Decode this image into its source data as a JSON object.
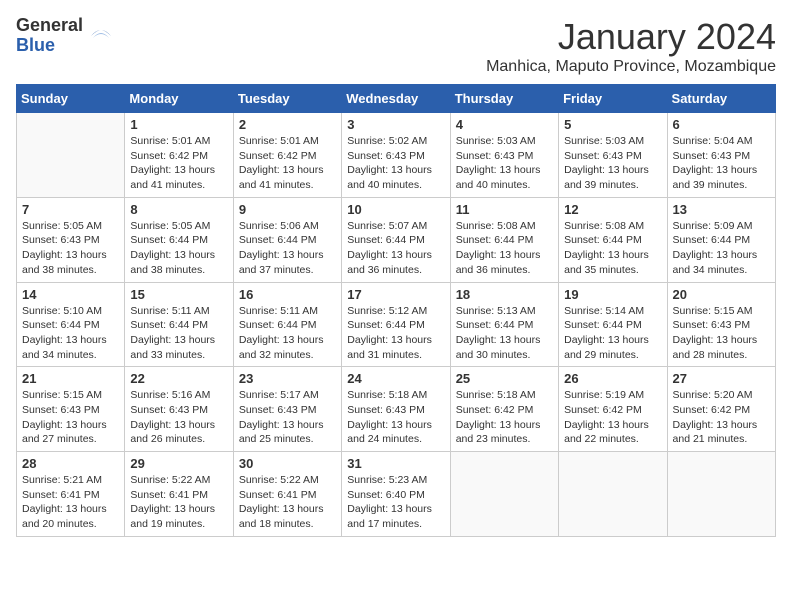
{
  "logo": {
    "general": "General",
    "blue": "Blue"
  },
  "header": {
    "month": "January 2024",
    "location": "Manhica, Maputo Province, Mozambique"
  },
  "weekdays": [
    "Sunday",
    "Monday",
    "Tuesday",
    "Wednesday",
    "Thursday",
    "Friday",
    "Saturday"
  ],
  "weeks": [
    [
      {
        "day": null
      },
      {
        "day": 1,
        "sunrise": "5:01 AM",
        "sunset": "6:42 PM",
        "daylight": "13 hours and 41 minutes."
      },
      {
        "day": 2,
        "sunrise": "5:01 AM",
        "sunset": "6:42 PM",
        "daylight": "13 hours and 41 minutes."
      },
      {
        "day": 3,
        "sunrise": "5:02 AM",
        "sunset": "6:43 PM",
        "daylight": "13 hours and 40 minutes."
      },
      {
        "day": 4,
        "sunrise": "5:03 AM",
        "sunset": "6:43 PM",
        "daylight": "13 hours and 40 minutes."
      },
      {
        "day": 5,
        "sunrise": "5:03 AM",
        "sunset": "6:43 PM",
        "daylight": "13 hours and 39 minutes."
      },
      {
        "day": 6,
        "sunrise": "5:04 AM",
        "sunset": "6:43 PM",
        "daylight": "13 hours and 39 minutes."
      }
    ],
    [
      {
        "day": 7,
        "sunrise": "5:05 AM",
        "sunset": "6:43 PM",
        "daylight": "13 hours and 38 minutes."
      },
      {
        "day": 8,
        "sunrise": "5:05 AM",
        "sunset": "6:44 PM",
        "daylight": "13 hours and 38 minutes."
      },
      {
        "day": 9,
        "sunrise": "5:06 AM",
        "sunset": "6:44 PM",
        "daylight": "13 hours and 37 minutes."
      },
      {
        "day": 10,
        "sunrise": "5:07 AM",
        "sunset": "6:44 PM",
        "daylight": "13 hours and 36 minutes."
      },
      {
        "day": 11,
        "sunrise": "5:08 AM",
        "sunset": "6:44 PM",
        "daylight": "13 hours and 36 minutes."
      },
      {
        "day": 12,
        "sunrise": "5:08 AM",
        "sunset": "6:44 PM",
        "daylight": "13 hours and 35 minutes."
      },
      {
        "day": 13,
        "sunrise": "5:09 AM",
        "sunset": "6:44 PM",
        "daylight": "13 hours and 34 minutes."
      }
    ],
    [
      {
        "day": 14,
        "sunrise": "5:10 AM",
        "sunset": "6:44 PM",
        "daylight": "13 hours and 34 minutes."
      },
      {
        "day": 15,
        "sunrise": "5:11 AM",
        "sunset": "6:44 PM",
        "daylight": "13 hours and 33 minutes."
      },
      {
        "day": 16,
        "sunrise": "5:11 AM",
        "sunset": "6:44 PM",
        "daylight": "13 hours and 32 minutes."
      },
      {
        "day": 17,
        "sunrise": "5:12 AM",
        "sunset": "6:44 PM",
        "daylight": "13 hours and 31 minutes."
      },
      {
        "day": 18,
        "sunrise": "5:13 AM",
        "sunset": "6:44 PM",
        "daylight": "13 hours and 30 minutes."
      },
      {
        "day": 19,
        "sunrise": "5:14 AM",
        "sunset": "6:44 PM",
        "daylight": "13 hours and 29 minutes."
      },
      {
        "day": 20,
        "sunrise": "5:15 AM",
        "sunset": "6:43 PM",
        "daylight": "13 hours and 28 minutes."
      }
    ],
    [
      {
        "day": 21,
        "sunrise": "5:15 AM",
        "sunset": "6:43 PM",
        "daylight": "13 hours and 27 minutes."
      },
      {
        "day": 22,
        "sunrise": "5:16 AM",
        "sunset": "6:43 PM",
        "daylight": "13 hours and 26 minutes."
      },
      {
        "day": 23,
        "sunrise": "5:17 AM",
        "sunset": "6:43 PM",
        "daylight": "13 hours and 25 minutes."
      },
      {
        "day": 24,
        "sunrise": "5:18 AM",
        "sunset": "6:43 PM",
        "daylight": "13 hours and 24 minutes."
      },
      {
        "day": 25,
        "sunrise": "5:18 AM",
        "sunset": "6:42 PM",
        "daylight": "13 hours and 23 minutes."
      },
      {
        "day": 26,
        "sunrise": "5:19 AM",
        "sunset": "6:42 PM",
        "daylight": "13 hours and 22 minutes."
      },
      {
        "day": 27,
        "sunrise": "5:20 AM",
        "sunset": "6:42 PM",
        "daylight": "13 hours and 21 minutes."
      }
    ],
    [
      {
        "day": 28,
        "sunrise": "5:21 AM",
        "sunset": "6:41 PM",
        "daylight": "13 hours and 20 minutes."
      },
      {
        "day": 29,
        "sunrise": "5:22 AM",
        "sunset": "6:41 PM",
        "daylight": "13 hours and 19 minutes."
      },
      {
        "day": 30,
        "sunrise": "5:22 AM",
        "sunset": "6:41 PM",
        "daylight": "13 hours and 18 minutes."
      },
      {
        "day": 31,
        "sunrise": "5:23 AM",
        "sunset": "6:40 PM",
        "daylight": "13 hours and 17 minutes."
      },
      {
        "day": null
      },
      {
        "day": null
      },
      {
        "day": null
      }
    ]
  ],
  "labels": {
    "sunrise": "Sunrise:",
    "sunset": "Sunset:",
    "daylight": "Daylight:"
  }
}
